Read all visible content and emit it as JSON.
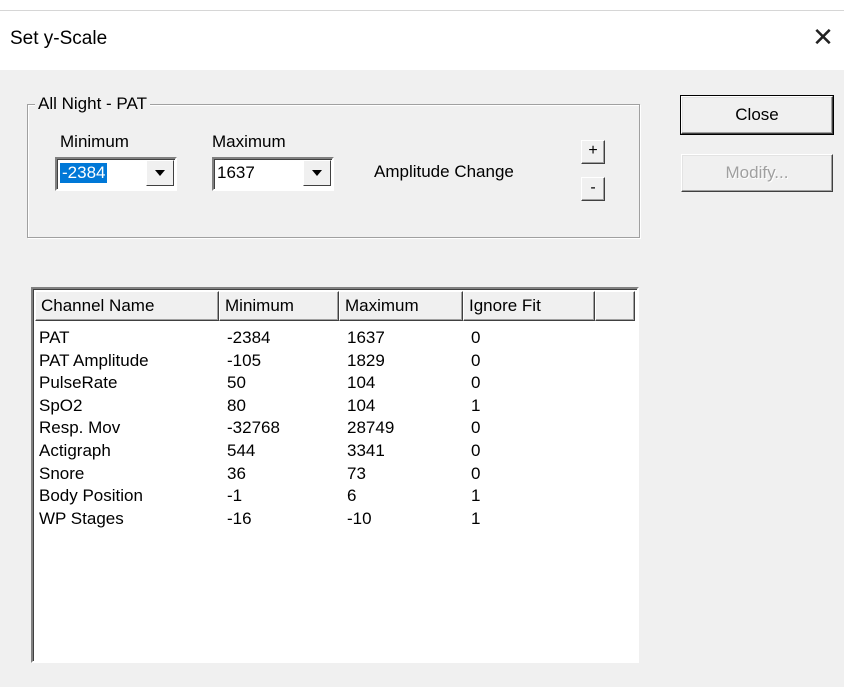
{
  "window": {
    "title": "Set y-Scale"
  },
  "group": {
    "label": "All Night - PAT",
    "minimum_label": "Minimum",
    "maximum_label": "Maximum",
    "minimum_value": "-2384",
    "maximum_value": "1637",
    "amplitude_label": "Amplitude Change",
    "plus_label": "+",
    "minus_label": "-"
  },
  "buttons": {
    "close": "Close",
    "modify": "Modify..."
  },
  "table": {
    "columns": [
      "Channel Name",
      "Minimum",
      "Maximum",
      "Ignore Fit"
    ],
    "rows": [
      [
        "PAT",
        "-2384",
        "1637",
        "0"
      ],
      [
        "PAT Amplitude",
        "-105",
        "1829",
        "0"
      ],
      [
        "PulseRate",
        "50",
        "104",
        "0"
      ],
      [
        "SpO2",
        "80",
        "104",
        "1"
      ],
      [
        "Resp. Mov",
        "-32768",
        "28749",
        "0"
      ],
      [
        "Actigraph",
        "544",
        "3341",
        "0"
      ],
      [
        "Snore",
        "36",
        "73",
        "0"
      ],
      [
        "Body Position",
        "-1",
        "6",
        "1"
      ],
      [
        "WP Stages",
        "-16",
        "-10",
        "1"
      ]
    ]
  }
}
